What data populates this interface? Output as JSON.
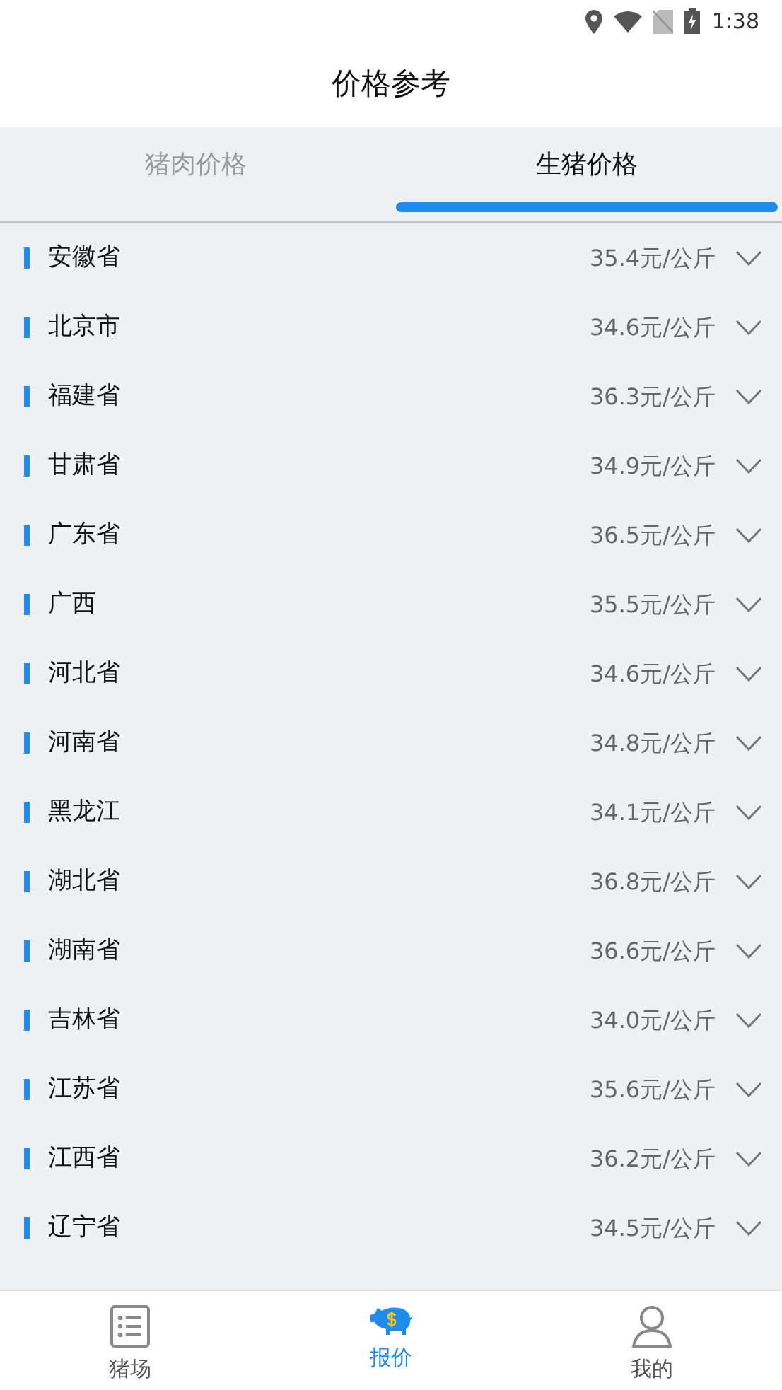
{
  "status_bar": {
    "time": "1:38"
  },
  "header": {
    "title": "价格参考"
  },
  "tabs": [
    {
      "label": "猪肉价格",
      "selected": false
    },
    {
      "label": "生猪价格",
      "selected": true
    }
  ],
  "prices": [
    {
      "province": "安徽省",
      "price": "35.4元/公斤"
    },
    {
      "province": "北京市",
      "price": "34.6元/公斤"
    },
    {
      "province": "福建省",
      "price": "36.3元/公斤"
    },
    {
      "province": "甘肃省",
      "price": "34.9元/公斤"
    },
    {
      "province": "广东省",
      "price": "36.5元/公斤"
    },
    {
      "province": "广西",
      "price": "35.5元/公斤"
    },
    {
      "province": "河北省",
      "price": "34.6元/公斤"
    },
    {
      "province": "河南省",
      "price": "34.8元/公斤"
    },
    {
      "province": "黑龙江",
      "price": "34.1元/公斤"
    },
    {
      "province": "湖北省",
      "price": "36.8元/公斤"
    },
    {
      "province": "湖南省",
      "price": "36.6元/公斤"
    },
    {
      "province": "吉林省",
      "price": "34.0元/公斤"
    },
    {
      "province": "江苏省",
      "price": "35.6元/公斤"
    },
    {
      "province": "江西省",
      "price": "36.2元/公斤"
    },
    {
      "province": "辽宁省",
      "price": "34.5元/公斤"
    }
  ],
  "bottom_nav": [
    {
      "label": "猪场",
      "kind": "list",
      "selected": false
    },
    {
      "label": "报价",
      "kind": "pig",
      "selected": true
    },
    {
      "label": "我的",
      "kind": "person",
      "selected": false
    }
  ]
}
